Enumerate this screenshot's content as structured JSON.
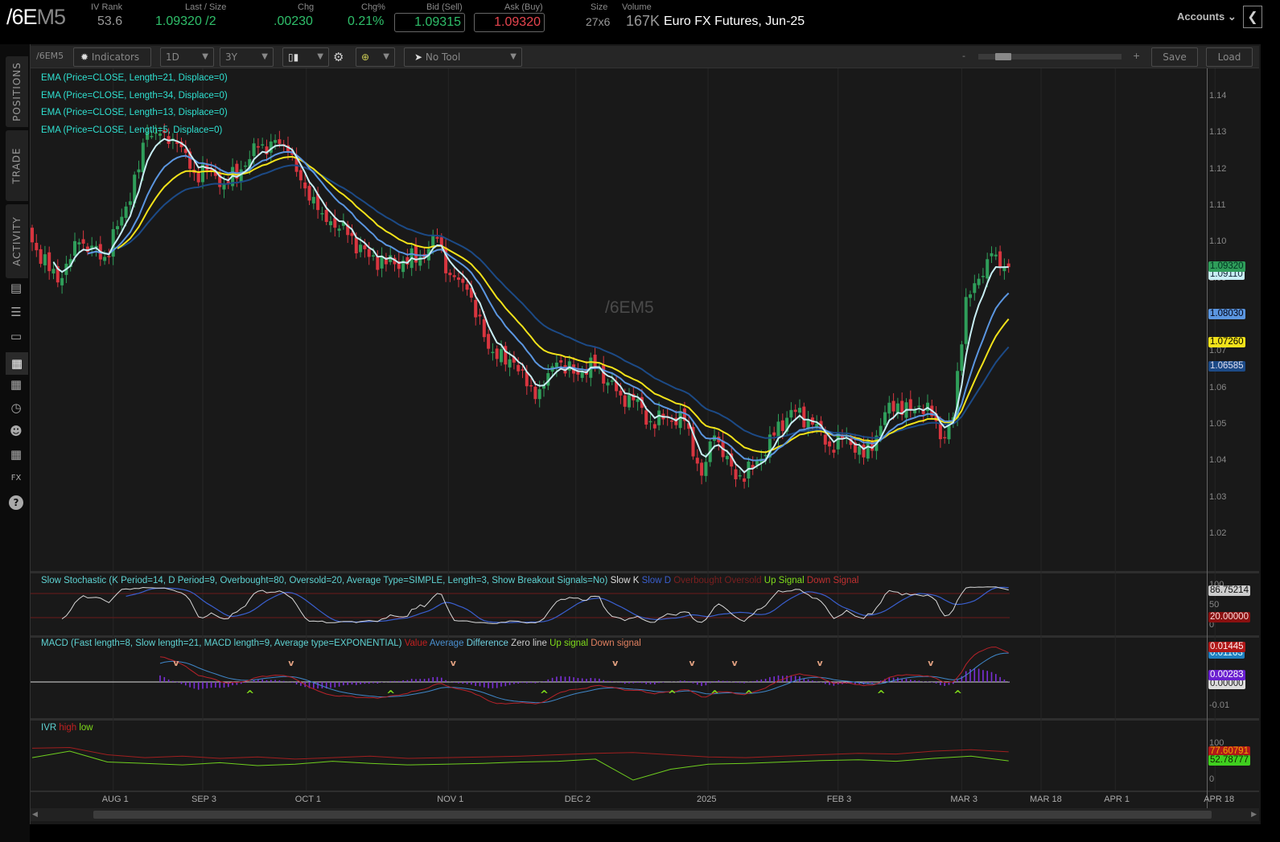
{
  "header": {
    "symbol_main": "/6E",
    "symbol_suffix": "M5",
    "iv_rank_label": "IV Rank",
    "iv_rank": "53.6",
    "last_label": "Last / Size",
    "last": "1.09320",
    "last_size": "/2",
    "chg_label": "Chg",
    "chg": ".00230",
    "chg_pct_label": "Chg%",
    "chg_pct": "0.21%",
    "bid_label": "Bid (Sell)",
    "bid": "1.09315",
    "ask_label": "Ask (Buy)",
    "ask": "1.09320",
    "size_label": "Size",
    "size": "27x6",
    "volume_label": "Volume",
    "volume": "167K",
    "description": "Euro FX Futures, Jun-25",
    "accounts_label": "Accounts"
  },
  "sidebar": {
    "tabs": [
      "POSITIONS",
      "TRADE",
      "ACTIVITY"
    ],
    "icons": [
      "news-icon",
      "watchlist-icon",
      "tv-icon",
      "charts-icon",
      "grid-icon",
      "clock-icon",
      "community-icon",
      "calendar-icon",
      "fx-icon",
      "help-icon"
    ]
  },
  "toolbar": {
    "symbol": "/6EM5",
    "indicators_label": "Indicators",
    "timeframe": "1D",
    "range": "3Y",
    "tool": "No Tool",
    "zoom_minus": "-",
    "zoom_plus": "+",
    "zoom_level": 0.12,
    "save_label": "Save",
    "load_label": "Load"
  },
  "price_legend": [
    "EMA (Price=CLOSE, Length=21, Displace=0)",
    "EMA (Price=CLOSE, Length=34, Displace=0)",
    "EMA (Price=CLOSE, Length=13, Displace=0)",
    "EMA (Price=CLOSE, Length=5, Displace=0)"
  ],
  "watermark": "/6EM5",
  "stoch_legend": {
    "title": "Slow Stochastic (K Period=14, D Period=9, Overbought=80, Oversold=20, Average Type=SIMPLE, Length=3, Show Breakout Signals=No)",
    "slow_k": "Slow K",
    "slow_d": "Slow D",
    "overbought": "Overbought",
    "oversold": "Oversold",
    "up": "Up Signal",
    "down": "Down Signal"
  },
  "macd_legend": {
    "title": "MACD (Fast length=8, Slow length=21, MACD length=9, Average type=EXPONENTIAL)",
    "value": "Value",
    "average": "Average",
    "difference": "Difference",
    "zero": "Zero line",
    "up": "Up signal",
    "down": "Down signal"
  },
  "ivr_legend": {
    "title": "IVR",
    "high": "high",
    "low": "low"
  },
  "chart_data": {
    "type": "candlestick",
    "symbol": "/6EM5",
    "y_ticks": [
      "1.14",
      "1.13",
      "1.12",
      "1.11",
      "1.10",
      "1.09",
      "1.08",
      "1.07",
      "1.06",
      "1.05",
      "1.04",
      "1.03",
      "1.02"
    ],
    "ylim": [
      1.015,
      1.1475
    ],
    "x_ticks": [
      [
        "AUG 1",
        19
      ],
      [
        "SEP 3",
        40
      ],
      [
        "OCT 1",
        64.3
      ],
      [
        "NOV 1",
        97.6
      ],
      [
        "DEC 2",
        127.5
      ],
      [
        "2025",
        158.5
      ],
      [
        "FEB 3",
        189
      ],
      [
        "MAR 3",
        218
      ],
      [
        "MAR 18",
        236.6
      ],
      [
        "APR 1",
        254
      ],
      [
        "APR 18",
        277.4
      ]
    ],
    "close_waypoints": [
      [
        0,
        1.1
      ],
      [
        6,
        1.089
      ],
      [
        11,
        1.1
      ],
      [
        17,
        1.096
      ],
      [
        21,
        1.107
      ],
      [
        25,
        1.12
      ],
      [
        27,
        1.13
      ],
      [
        31,
        1.13
      ],
      [
        34,
        1.127
      ],
      [
        38,
        1.119
      ],
      [
        42,
        1.12
      ],
      [
        45,
        1.116
      ],
      [
        49,
        1.12
      ],
      [
        53,
        1.126
      ],
      [
        58,
        1.127
      ],
      [
        60,
        1.125
      ],
      [
        63,
        1.117
      ],
      [
        68,
        1.108
      ],
      [
        74,
        1.102
      ],
      [
        79,
        1.096
      ],
      [
        85,
        1.094
      ],
      [
        91,
        1.096
      ],
      [
        95,
        1.101
      ],
      [
        98,
        1.091
      ],
      [
        102,
        1.087
      ],
      [
        106,
        1.074
      ],
      [
        109,
        1.068
      ],
      [
        113,
        1.067
      ],
      [
        118,
        1.057
      ],
      [
        123,
        1.067
      ],
      [
        127,
        1.064
      ],
      [
        132,
        1.066
      ],
      [
        138,
        1.058
      ],
      [
        142,
        1.057
      ],
      [
        144,
        1.05
      ],
      [
        149,
        1.052
      ],
      [
        153,
        1.051
      ],
      [
        157,
        1.036
      ],
      [
        160,
        1.047
      ],
      [
        165,
        1.035
      ],
      [
        169,
        1.038
      ],
      [
        174,
        1.047
      ],
      [
        178,
        1.054
      ],
      [
        183,
        1.05
      ],
      [
        187,
        1.044
      ],
      [
        191,
        1.047
      ],
      [
        195,
        1.041
      ],
      [
        198,
        1.047
      ],
      [
        201,
        1.056
      ],
      [
        206,
        1.054
      ],
      [
        210,
        1.056
      ],
      [
        213,
        1.046
      ],
      [
        216,
        1.052
      ],
      [
        218,
        1.072
      ],
      [
        219,
        1.085
      ],
      [
        222,
        1.09
      ],
      [
        225,
        1.097
      ],
      [
        227,
        1.093
      ],
      [
        229,
        1.0932
      ]
    ],
    "emas": [
      {
        "length": 5,
        "color": "#c8eef4",
        "last": "1.09110",
        "text_color": "#123"
      },
      {
        "length": 13,
        "color": "#5b96e0",
        "last": "1.08030",
        "text_color": "#001"
      },
      {
        "length": 21,
        "color": "#f2e21a",
        "last": "1.07260",
        "text_color": "#000"
      },
      {
        "length": 34,
        "color": "#1c4a86",
        "last": "1.06585",
        "text_color": "#dde"
      }
    ],
    "last_price": "1.09320",
    "stochastic": {
      "overbought": 80,
      "oversold": 20,
      "ticks": [
        "100",
        "50",
        "0"
      ],
      "last_k": "86.75214",
      "oversold_label": "20.00000"
    },
    "macd": {
      "ticks": [
        "0.01",
        "-0.01"
      ],
      "value_last": "0.01445",
      "average_last": "0.01163",
      "diff_last": "0.00283",
      "zero_label": "0.00000"
    },
    "ivr": {
      "ticks": [
        "100",
        "0"
      ],
      "high_last": "77.60791",
      "low_last": "52.78777",
      "high": [
        88,
        90,
        70,
        62,
        66,
        60,
        64,
        58,
        62,
        66,
        60,
        62,
        64,
        66,
        70,
        74,
        76,
        70,
        64,
        62,
        66,
        70,
        74,
        72,
        80,
        84,
        78
      ],
      "value": [
        62,
        80,
        50,
        46,
        42,
        48,
        40,
        44,
        52,
        46,
        42,
        44,
        46,
        50,
        52,
        58,
        0,
        30,
        44,
        46,
        50,
        54,
        56,
        52,
        60,
        66,
        53
      ]
    },
    "colors": {
      "up": "#2f9e5a",
      "down": "#d8353f",
      "stoch_k": "#d8d8d8",
      "stoch_d": "#3a5fcf",
      "ob_os": "#6b1a1a",
      "macd_value": "#b8222a",
      "macd_avg": "#3f86c8",
      "macd_diff": "#7b2fd8",
      "ivr_high": "#a01f1f",
      "ivr_low": "#6fcf1f"
    }
  }
}
